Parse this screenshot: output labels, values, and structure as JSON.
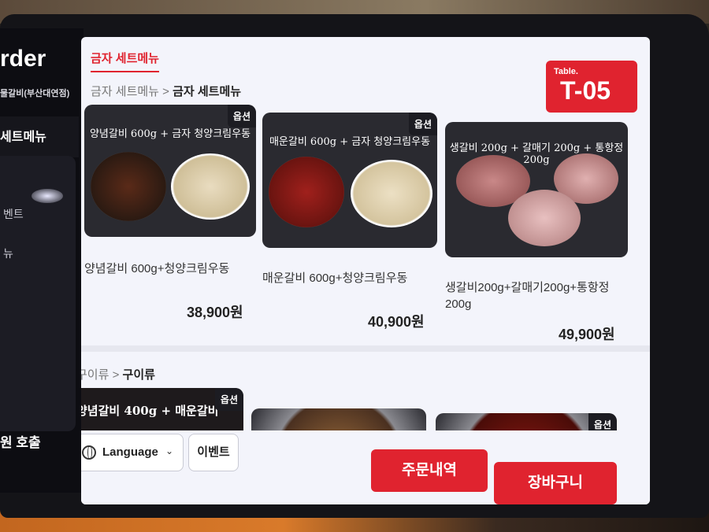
{
  "sidebar": {
    "logo_text": "rder",
    "store_name": "물갈비(부산대연점)",
    "active_item": "세트메뉴",
    "items": [
      "벤트",
      "뉴"
    ],
    "call_button": "원 호출"
  },
  "main": {
    "tab_label": "금자 세트메뉴",
    "breadcrumb": {
      "parent": "금자 세트메뉴",
      "separator": " > ",
      "current": "금자 세트메뉴"
    },
    "table": {
      "label": "Table.",
      "number": "T-05"
    },
    "option_badge": "옵션",
    "set_items": [
      {
        "image_text": "양념갈비 600g + 금자 청양크림우동",
        "name": "양념갈비 600g+청양크림우동",
        "price": "38,900원",
        "has_option": true
      },
      {
        "image_text": "매운갈비 600g + 금자 청양크림우동",
        "name": "매운갈비 600g+청양크림우동",
        "price": "40,900원",
        "has_option": true
      },
      {
        "image_text": "생갈비 200g + 갈매기 200g + 통항정 200g",
        "name": "생갈비200g+갈매기200g+통항정 200g",
        "price": "49,900원",
        "has_option": false
      }
    ],
    "grill_breadcrumb": {
      "parent": "구이류",
      "separator": " > ",
      "current": "구이류"
    },
    "grill_items": [
      {
        "image_text": "양념갈비 400g + 매운갈비",
        "has_option": true
      },
      {
        "image_text": "",
        "has_option": false
      },
      {
        "image_text": "",
        "has_option": true
      }
    ]
  },
  "bottom": {
    "language_label": "Language",
    "event_label": "이벤트",
    "order_history_label": "주문내역",
    "cart_label": "장바구니"
  },
  "colors": {
    "accent": "#e0232f",
    "panel_bg": "#f3f4fb",
    "sidebar_bg": "#0d0d12"
  }
}
